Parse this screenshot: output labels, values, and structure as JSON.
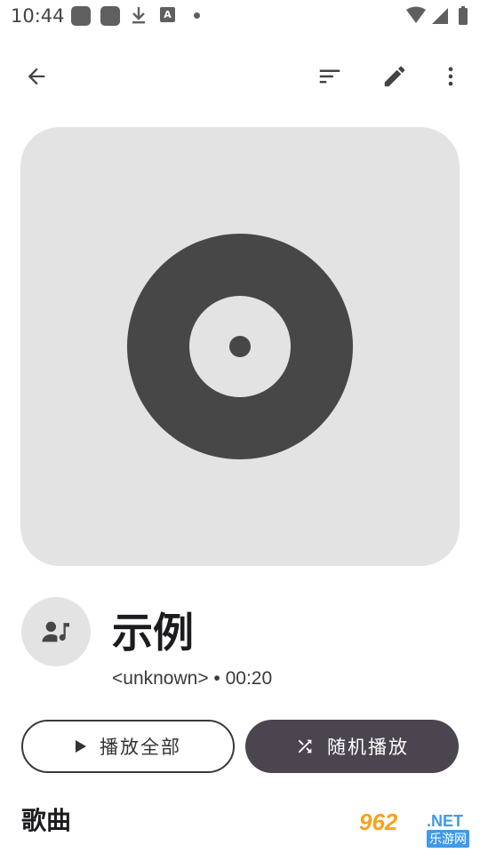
{
  "status_bar": {
    "time": "10:44",
    "a_badge": "A"
  },
  "app_bar": {
    "icons": [
      "back-arrow-icon",
      "sort-icon",
      "edit-pencil-icon",
      "more-vert-icon"
    ]
  },
  "album": {
    "title": "示例",
    "subtitle": "<unknown> • 00:20"
  },
  "actions": {
    "play_all_label": "播放全部",
    "shuffle_label": "随机播放"
  },
  "songs_section": {
    "title": "歌曲"
  },
  "watermark": {
    "main": "962",
    "net": ".NET",
    "sub": "乐游网"
  },
  "colors": {
    "background": "#ffffff",
    "album_art_bg": "#e3e3e3",
    "disc": "#474747",
    "shuffle_button": "#4a454f",
    "watermark_orange": "#f7a21b",
    "watermark_blue": "#3d9be9"
  }
}
